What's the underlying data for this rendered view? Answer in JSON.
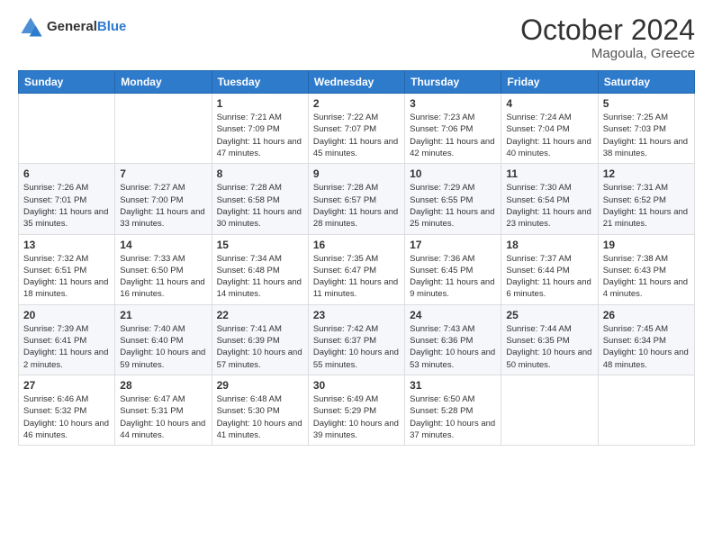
{
  "logo": {
    "text_general": "General",
    "text_blue": "Blue"
  },
  "header": {
    "title": "October 2024",
    "location": "Magoula, Greece"
  },
  "weekdays": [
    "Sunday",
    "Monday",
    "Tuesday",
    "Wednesday",
    "Thursday",
    "Friday",
    "Saturday"
  ],
  "weeks": [
    [
      {
        "day": "",
        "info": ""
      },
      {
        "day": "",
        "info": ""
      },
      {
        "day": "1",
        "info": "Sunrise: 7:21 AM\nSunset: 7:09 PM\nDaylight: 11 hours and 47 minutes."
      },
      {
        "day": "2",
        "info": "Sunrise: 7:22 AM\nSunset: 7:07 PM\nDaylight: 11 hours and 45 minutes."
      },
      {
        "day": "3",
        "info": "Sunrise: 7:23 AM\nSunset: 7:06 PM\nDaylight: 11 hours and 42 minutes."
      },
      {
        "day": "4",
        "info": "Sunrise: 7:24 AM\nSunset: 7:04 PM\nDaylight: 11 hours and 40 minutes."
      },
      {
        "day": "5",
        "info": "Sunrise: 7:25 AM\nSunset: 7:03 PM\nDaylight: 11 hours and 38 minutes."
      }
    ],
    [
      {
        "day": "6",
        "info": "Sunrise: 7:26 AM\nSunset: 7:01 PM\nDaylight: 11 hours and 35 minutes."
      },
      {
        "day": "7",
        "info": "Sunrise: 7:27 AM\nSunset: 7:00 PM\nDaylight: 11 hours and 33 minutes."
      },
      {
        "day": "8",
        "info": "Sunrise: 7:28 AM\nSunset: 6:58 PM\nDaylight: 11 hours and 30 minutes."
      },
      {
        "day": "9",
        "info": "Sunrise: 7:28 AM\nSunset: 6:57 PM\nDaylight: 11 hours and 28 minutes."
      },
      {
        "day": "10",
        "info": "Sunrise: 7:29 AM\nSunset: 6:55 PM\nDaylight: 11 hours and 25 minutes."
      },
      {
        "day": "11",
        "info": "Sunrise: 7:30 AM\nSunset: 6:54 PM\nDaylight: 11 hours and 23 minutes."
      },
      {
        "day": "12",
        "info": "Sunrise: 7:31 AM\nSunset: 6:52 PM\nDaylight: 11 hours and 21 minutes."
      }
    ],
    [
      {
        "day": "13",
        "info": "Sunrise: 7:32 AM\nSunset: 6:51 PM\nDaylight: 11 hours and 18 minutes."
      },
      {
        "day": "14",
        "info": "Sunrise: 7:33 AM\nSunset: 6:50 PM\nDaylight: 11 hours and 16 minutes."
      },
      {
        "day": "15",
        "info": "Sunrise: 7:34 AM\nSunset: 6:48 PM\nDaylight: 11 hours and 14 minutes."
      },
      {
        "day": "16",
        "info": "Sunrise: 7:35 AM\nSunset: 6:47 PM\nDaylight: 11 hours and 11 minutes."
      },
      {
        "day": "17",
        "info": "Sunrise: 7:36 AM\nSunset: 6:45 PM\nDaylight: 11 hours and 9 minutes."
      },
      {
        "day": "18",
        "info": "Sunrise: 7:37 AM\nSunset: 6:44 PM\nDaylight: 11 hours and 6 minutes."
      },
      {
        "day": "19",
        "info": "Sunrise: 7:38 AM\nSunset: 6:43 PM\nDaylight: 11 hours and 4 minutes."
      }
    ],
    [
      {
        "day": "20",
        "info": "Sunrise: 7:39 AM\nSunset: 6:41 PM\nDaylight: 11 hours and 2 minutes."
      },
      {
        "day": "21",
        "info": "Sunrise: 7:40 AM\nSunset: 6:40 PM\nDaylight: 10 hours and 59 minutes."
      },
      {
        "day": "22",
        "info": "Sunrise: 7:41 AM\nSunset: 6:39 PM\nDaylight: 10 hours and 57 minutes."
      },
      {
        "day": "23",
        "info": "Sunrise: 7:42 AM\nSunset: 6:37 PM\nDaylight: 10 hours and 55 minutes."
      },
      {
        "day": "24",
        "info": "Sunrise: 7:43 AM\nSunset: 6:36 PM\nDaylight: 10 hours and 53 minutes."
      },
      {
        "day": "25",
        "info": "Sunrise: 7:44 AM\nSunset: 6:35 PM\nDaylight: 10 hours and 50 minutes."
      },
      {
        "day": "26",
        "info": "Sunrise: 7:45 AM\nSunset: 6:34 PM\nDaylight: 10 hours and 48 minutes."
      }
    ],
    [
      {
        "day": "27",
        "info": "Sunrise: 6:46 AM\nSunset: 5:32 PM\nDaylight: 10 hours and 46 minutes."
      },
      {
        "day": "28",
        "info": "Sunrise: 6:47 AM\nSunset: 5:31 PM\nDaylight: 10 hours and 44 minutes."
      },
      {
        "day": "29",
        "info": "Sunrise: 6:48 AM\nSunset: 5:30 PM\nDaylight: 10 hours and 41 minutes."
      },
      {
        "day": "30",
        "info": "Sunrise: 6:49 AM\nSunset: 5:29 PM\nDaylight: 10 hours and 39 minutes."
      },
      {
        "day": "31",
        "info": "Sunrise: 6:50 AM\nSunset: 5:28 PM\nDaylight: 10 hours and 37 minutes."
      },
      {
        "day": "",
        "info": ""
      },
      {
        "day": "",
        "info": ""
      }
    ]
  ]
}
